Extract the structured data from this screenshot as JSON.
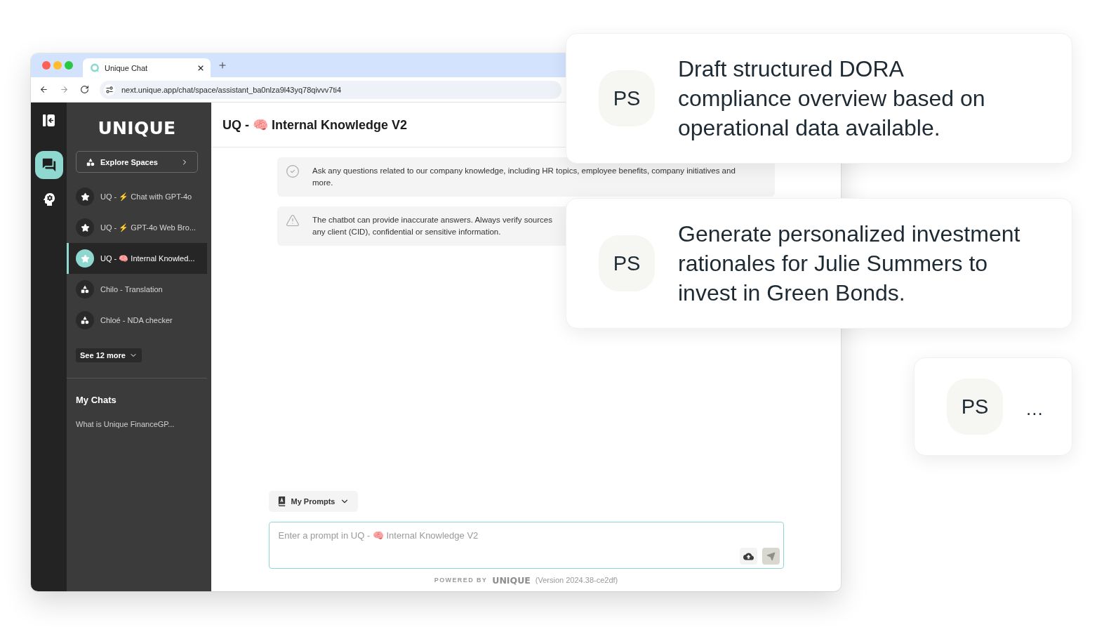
{
  "browser": {
    "tabs": [
      {
        "title": "Unique Chat",
        "selected": true
      }
    ],
    "address": "next.unique.app/chat/space/assistant_ba0nlza9l43yq78qivvv7ti4"
  },
  "rail": [
    {
      "kind": "chats",
      "selected": true
    },
    {
      "kind": "prompts",
      "selected": false
    }
  ],
  "sidebar": {
    "logo": "UNIQUE",
    "explore_button": "Explore Spaces",
    "spaces": [
      {
        "label": "UQ - ⚡ Chat with GPT-4o",
        "kind": "favorite",
        "selected": false
      },
      {
        "label": "UQ - ⚡ GPT-4o Web Bro...",
        "kind": "favorite",
        "selected": false
      },
      {
        "label": "UQ - 🧠 Internal Knowled...",
        "kind": "favorite",
        "selected": true
      },
      {
        "label": "Chilo - Translation",
        "kind": "space",
        "selected": false
      },
      {
        "label": "Chloé - NDA checker",
        "kind": "space",
        "selected": false
      }
    ],
    "see_more_button": "See 12 more",
    "chats_heading": "My Chats",
    "chats": [
      {
        "title": "What is Unique FinanceGP...",
        "selected": false
      }
    ]
  },
  "chat": {
    "title": "UQ - 🧠 Internal Knowledge V2",
    "notices": [
      {
        "kind": "info",
        "text": "Ask any questions related to our company knowledge, including HR topics, employee benefits, company initiatives and more."
      },
      {
        "kind": "warning",
        "lines": [
          "The chatbot can provide inaccurate answers. Always verify sources",
          "any client (CID), confidential or sensitive information."
        ]
      }
    ],
    "prompts_button": "My Prompts",
    "prompt_input": {
      "placeholder": "Enter a prompt in UQ - 🧠 Internal Knowledge V2"
    },
    "footer": {
      "powered_by": "POWERED BY",
      "logo": "UNIQUE",
      "version": "(Version 2024.38-ce2df)"
    }
  },
  "floating_prompts": [
    {
      "kind": "prompt",
      "initials": "PS",
      "text": "Draft structured DORA compliance overview based on operational data available."
    },
    {
      "kind": "prompt",
      "initials": "PS",
      "text": "Generate personalized investment rationales for Julie Summers to invest in Green Bonds."
    },
    {
      "kind": "typing",
      "initials": "PS",
      "text": "..."
    }
  ]
}
